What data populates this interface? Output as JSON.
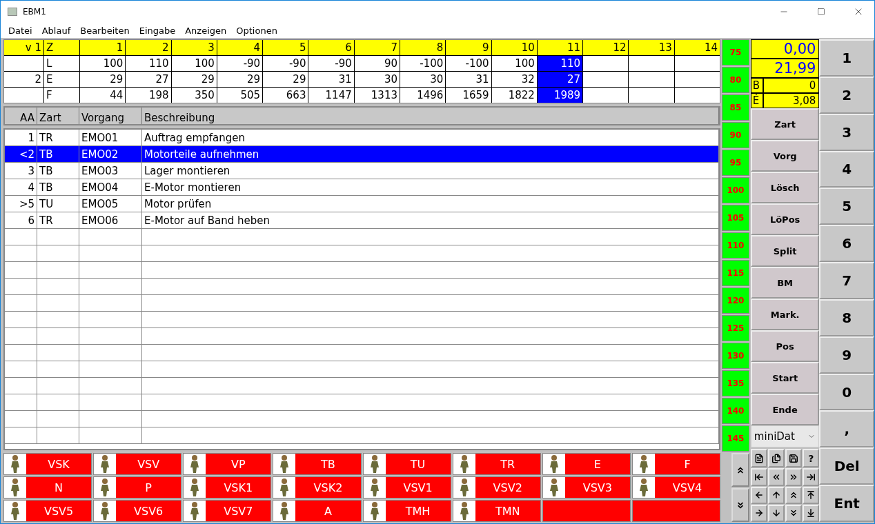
{
  "window": {
    "title": "EBM1"
  },
  "menu": [
    "Datei",
    "Ablauf",
    "Bearbeiten",
    "Eingabe",
    "Anzeigen",
    "Optionen"
  ],
  "grid": {
    "header": {
      "label": "v 1",
      "type": "Z"
    },
    "columns": [
      {
        "label": "1",
        "selected": false
      },
      {
        "label": "2",
        "selected": false
      },
      {
        "label": "3",
        "selected": false
      },
      {
        "label": "4",
        "selected": false
      },
      {
        "label": "5",
        "selected": false
      },
      {
        "label": "6",
        "selected": false
      },
      {
        "label": "7",
        "selected": false
      },
      {
        "label": "8",
        "selected": false
      },
      {
        "label": "9",
        "selected": false
      },
      {
        "label": "10",
        "selected": false
      },
      {
        "label": "11",
        "selected": true
      },
      {
        "label": "12",
        "selected": false
      },
      {
        "label": "13",
        "selected": false
      },
      {
        "label": "14",
        "selected": false
      }
    ],
    "rows": [
      {
        "type": "L",
        "values": [
          "100",
          "110",
          "100",
          "-90",
          "-90",
          "-90",
          "90",
          "-100",
          "-100",
          "100",
          "110"
        ]
      },
      {
        "label": "2",
        "type": "E",
        "values": [
          "29",
          "27",
          "29",
          "29",
          "29",
          "31",
          "30",
          "30",
          "31",
          "32",
          "27"
        ]
      },
      {
        "type": "F",
        "values": [
          "44",
          "198",
          "350",
          "505",
          "663",
          "1147",
          "1313",
          "1496",
          "1659",
          "1822",
          "1989"
        ]
      }
    ]
  },
  "list": {
    "columns": [
      "AA",
      "Zart",
      "Vorgang",
      "Beschreibung"
    ],
    "rows": [
      {
        "aa": "1",
        "zart": "TR",
        "vorgang": "EMO01",
        "text": "Auftrag empfangen",
        "selected": false
      },
      {
        "aa": "<2",
        "zart": "TB",
        "vorgang": "EMO02",
        "text": "Motorteile aufnehmen",
        "selected": true
      },
      {
        "aa": "3",
        "zart": "TB",
        "vorgang": "EMO03",
        "text": "Lager montieren",
        "selected": false
      },
      {
        "aa": "4",
        "zart": "TB",
        "vorgang": "EMO04",
        "text": "E-Motor montieren",
        "selected": false
      },
      {
        "aa": ">5",
        "zart": "TU",
        "vorgang": "EMO05",
        "text": "Motor prüfen",
        "selected": false
      },
      {
        "aa": "6",
        "zart": "TR",
        "vorgang": "EMO06",
        "text": "E-Motor auf Band heben",
        "selected": false
      }
    ]
  },
  "scale": [
    "75",
    "80",
    "85",
    "90",
    "95",
    "100",
    "105",
    "110",
    "115",
    "120",
    "125",
    "130",
    "135",
    "140",
    "145"
  ],
  "readouts": {
    "total": "0,00",
    "value": "21,99",
    "b_label": "B",
    "b_value": "0",
    "e_label": "É",
    "e_value": "3,08"
  },
  "actions": [
    "Zart",
    "Vorg",
    "Lösch",
    "LöPos",
    "Split",
    "BM",
    "Mark.",
    "Pos",
    "Start",
    "Ende"
  ],
  "dropdown": {
    "value": "miniDat"
  },
  "help_glyph": "?",
  "keypad": [
    "1",
    "2",
    "3",
    "4",
    "5",
    "6",
    "7",
    "8",
    "9",
    "0",
    ",",
    "Del",
    "Ent"
  ],
  "tools": [
    {
      "kind": "icon",
      "label": "VSK"
    },
    {
      "kind": "icon",
      "label": "VSV"
    },
    {
      "kind": "icon",
      "label": "VP"
    },
    {
      "kind": "icon",
      "label": "TB"
    },
    {
      "kind": "icon",
      "label": "TU"
    },
    {
      "kind": "icon",
      "label": "TR"
    },
    {
      "kind": "icon",
      "label": "E"
    },
    {
      "kind": "icon",
      "label": "F"
    },
    {
      "kind": "icon",
      "label": "N"
    },
    {
      "kind": "icon",
      "label": "P"
    },
    {
      "kind": "icon",
      "label": "VSK1"
    },
    {
      "kind": "icon",
      "label": "VSK2"
    },
    {
      "kind": "icon",
      "label": "VSV1"
    },
    {
      "kind": "icon",
      "label": "VSV2"
    },
    {
      "kind": "icon",
      "label": "VSV3"
    },
    {
      "kind": "icon",
      "label": "VSV4"
    },
    {
      "kind": "icon",
      "label": "VSV5"
    },
    {
      "kind": "icon",
      "label": "VSV6"
    },
    {
      "kind": "icon",
      "label": "VSV7"
    },
    {
      "kind": "icon",
      "label": "A"
    },
    {
      "kind": "icon",
      "label": "TMH"
    },
    {
      "kind": "icon",
      "label": "TMN"
    },
    {
      "kind": "blank"
    },
    {
      "kind": "blank"
    }
  ]
}
